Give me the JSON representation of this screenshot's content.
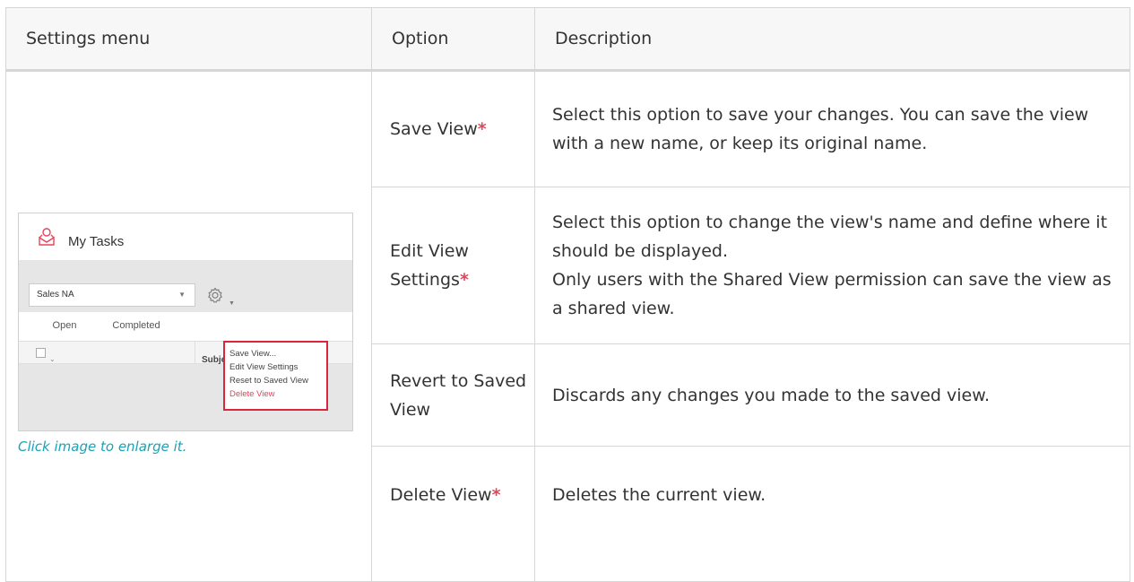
{
  "table": {
    "headers": [
      "Settings menu",
      "Option",
      "Description"
    ],
    "rows": [
      {
        "option": "Save View",
        "required": "*",
        "description": "Select this option to save your changes. You can save the view with a new name, or keep its original name."
      },
      {
        "option": "Edit View Settings",
        "required": "*",
        "description": "Select this option to change the view's name and define where it should be displayed.",
        "description_extra": "Only users with the Shared View permission can save the view as a shared view."
      },
      {
        "option": "Revert to Saved View",
        "required": "",
        "description": "Discards any changes you made to the saved view."
      },
      {
        "option": "Delete View",
        "required": "*",
        "description": "Deletes the current view."
      }
    ]
  },
  "thumbnail": {
    "title": "My Tasks",
    "selected_view": "Sales NA",
    "tabs": [
      "Open",
      "Completed"
    ],
    "grid_column": "Subject",
    "menu_items": [
      "Save View...",
      "Edit View Settings",
      "Reset to Saved View",
      "Delete View"
    ],
    "caption": "Click image to enlarge it.",
    "icons": [
      "task-icon",
      "gear-icon"
    ]
  },
  "colors": {
    "required_star": "#e8435a",
    "menu_border": "#d9263c",
    "link": "#19a3b5",
    "active_tab": "#1fa3b5"
  }
}
